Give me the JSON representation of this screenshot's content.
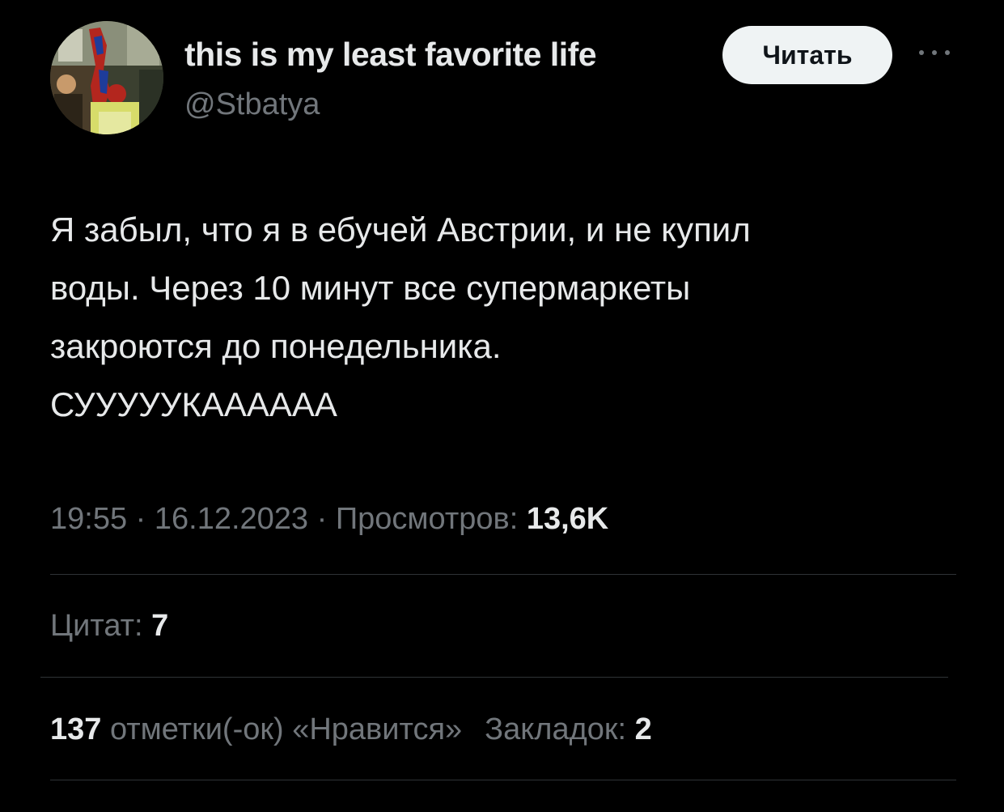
{
  "author": {
    "display_name": "this is my least favorite life",
    "handle": "@Stbatya",
    "avatar_icon": "user-avatar-photo"
  },
  "header": {
    "follow_label": "Читать",
    "more_icon": "ellipsis-icon"
  },
  "tweet": {
    "text": "Я забыл, что я в ебучей Австрии, и не купил\nводы. Через 10 минут все супермаркеты\nзакроются до понедельника.\nСУУУУУКАААААА"
  },
  "meta": {
    "time": "19:55",
    "separator": " · ",
    "date": "16.12.2023",
    "views_label": "Просмотров:",
    "views_value": "13,6K"
  },
  "stats": {
    "quotes_label": "Цитат:",
    "quotes_value": "7",
    "likes_value": "137",
    "likes_label": "отметки(-ок) «Нравится»",
    "bookmarks_label": "Закладок:",
    "bookmarks_value": "2"
  },
  "colors": {
    "background": "#000000",
    "primary_text": "#e7e9ea",
    "secondary_text": "#71767b",
    "divider": "#2f3336",
    "button_bg": "#eff3f4"
  }
}
